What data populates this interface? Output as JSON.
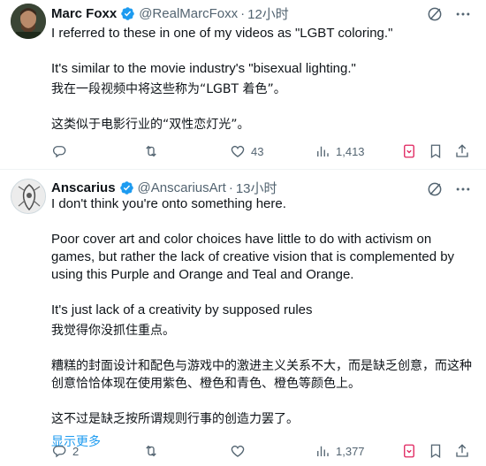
{
  "tweets": [
    {
      "name": "Marc Foxx",
      "handle": "@RealMarcFoxx",
      "time": "12小时",
      "lines_en": [
        "I referred to these in one of my videos as \"LGBT coloring.\"",
        "It's similar to the movie industry's \"bisexual lighting.\""
      ],
      "lines_cn": [
        "我在一段视频中将这些称为“LGBT 着色”。",
        "这类似于电影行业的“双性恋灯光”。"
      ],
      "stats": {
        "replies": "",
        "retweets": "",
        "likes": "43",
        "views": "1,413"
      }
    },
    {
      "name": "Anscarius",
      "handle": "@AnscariusArt",
      "time": "13小时",
      "line1": "I don't think you're onto something here.",
      "para2": "Poor cover art and color choices have little to do with activism on games, but rather the lack of creative vision that is complemented by using this Purple and Orange and Teal and Orange.",
      "line3": "It's just lack of a creativity by supposed rules",
      "cn1": "我觉得你没抓住重点。",
      "cn2a": "糟糕的封面设计和配色与游戏中的激进主义关系不大，而是缺乏创意，而这种",
      "cn2b": "创意恰恰体现在使用紫色、橙色和青色、橙色等颜色上。",
      "cn3": "这不过是缺乏按所谓规则行事的创造力罢了。",
      "show_more": "显示更多",
      "stats": {
        "replies": "2",
        "retweets": "",
        "likes": "",
        "views": "1,377"
      }
    }
  ],
  "colors": {
    "text": "#0f1419",
    "secondary": "#536471",
    "link": "#1d9bf0",
    "verified": "#1d9bf0",
    "grok": "#e0245e"
  },
  "icons": [
    "verified-badge-icon",
    "grok-icon",
    "more-icon",
    "reply-icon",
    "retweet-icon",
    "like-icon",
    "views-icon",
    "bookmark-icon",
    "share-icon"
  ]
}
